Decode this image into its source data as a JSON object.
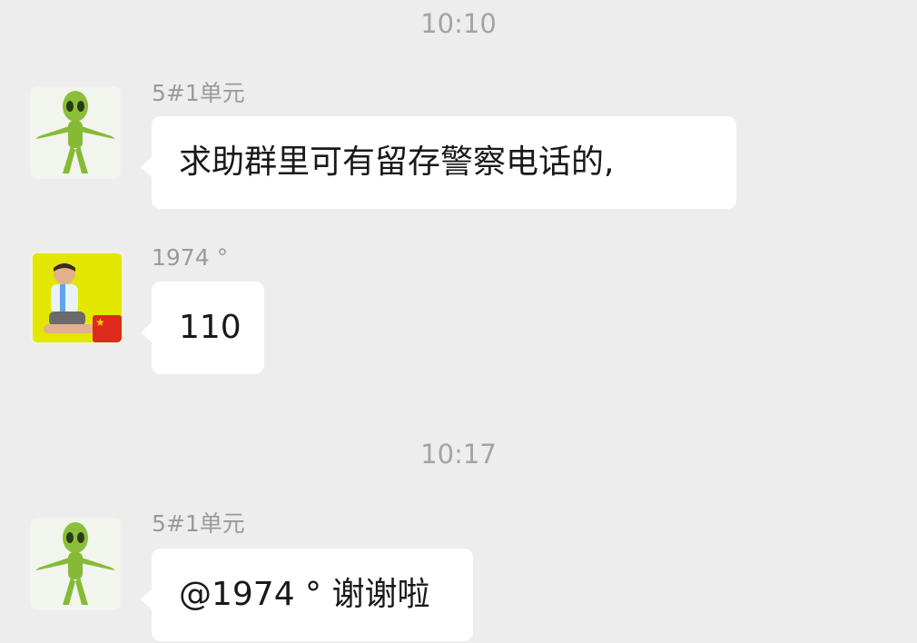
{
  "timestamps": [
    "10:10",
    "10:17"
  ],
  "messages": [
    {
      "sender": "5#1单元",
      "text": "求助群里可有留存警察电话的,",
      "avatar": "alien-icon"
    },
    {
      "sender": "1974 °",
      "text": "110",
      "avatar": "child-photo"
    },
    {
      "sender": "5#1单元",
      "text": "@1974 ° 谢谢啦",
      "avatar": "alien-icon"
    }
  ],
  "colors": {
    "background": "#ededed",
    "bubble": "#ffffff",
    "timestamp": "#a3a3a3",
    "sender": "#9a9a9a",
    "text": "#191919",
    "alien_green": "#8bbf3a",
    "kid_background": "#e2e600"
  }
}
